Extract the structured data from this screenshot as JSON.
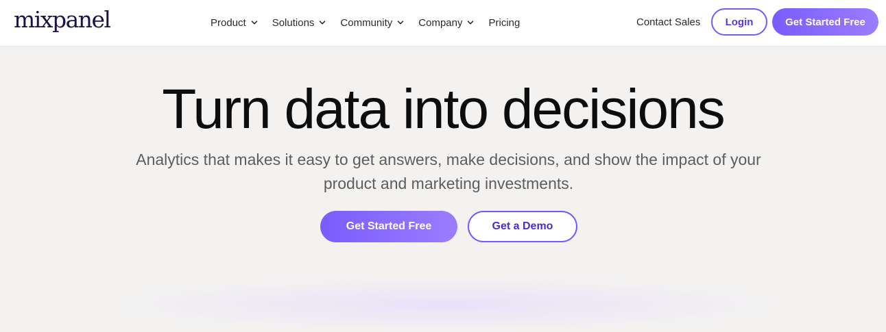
{
  "brand": {
    "logo_text": "mixpanel",
    "accent": "#7856ff",
    "logo_color": "#1f1147"
  },
  "nav": {
    "items": [
      {
        "label": "Product",
        "icon": "chevron-down-icon"
      },
      {
        "label": "Solutions",
        "icon": "chevron-down-icon"
      },
      {
        "label": "Community",
        "icon": "chevron-down-icon"
      },
      {
        "label": "Company",
        "icon": "chevron-down-icon"
      },
      {
        "label": "Pricing"
      }
    ],
    "contact_label": "Contact Sales",
    "login_label": "Login",
    "get_started_label": "Get Started Free"
  },
  "hero": {
    "title": "Turn data into decisions",
    "subtitle": "Analytics that makes it easy to get answers, make decisions, and show the impact of your product and marketing investments.",
    "primary_cta": "Get Started Free",
    "secondary_cta": "Get a Demo"
  }
}
